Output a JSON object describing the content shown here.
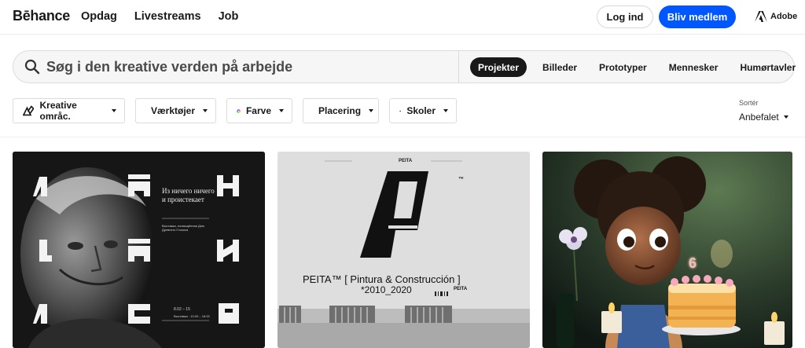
{
  "header": {
    "logo": "Bēhance",
    "nav": [
      "Opdag",
      "Livestreams",
      "Job"
    ],
    "login_label": "Log ind",
    "signup_label": "Bliv medlem",
    "adobe_label": "Adobe",
    "signup_color": "#0057ff"
  },
  "search": {
    "placeholder": "Søg i den kreative verden på arbejde",
    "tabs": [
      "Projekter",
      "Billeder",
      "Prototyper",
      "Mennesker",
      "Humørtavler"
    ],
    "active_tab": "Projekter"
  },
  "filters": [
    {
      "label": "Kreative områc.",
      "icon": "creative-fields-icon"
    },
    {
      "label": "Værktøjer",
      "icon": "tools-icon"
    },
    {
      "label": "Farve",
      "icon": "color-wheel-icon"
    },
    {
      "label": "Placering",
      "icon": "location-pin-icon"
    },
    {
      "label": "Skoler",
      "icon": "graduation-cap-icon"
    }
  ],
  "sort": {
    "label": "Sortér",
    "value": "Anbefalet"
  },
  "cards": [
    {
      "poster_heading": "Из ничего ничего и проистекает",
      "poster_small": "Выставка, посвящённая Дню Древнего Гнозиса",
      "poster_date": "8.02 – 15",
      "poster_date_sub": "Выставка · 10:00 – 18:00"
    },
    {
      "top_label": "PEITA",
      "title": "PEITA™ [ Pintura & Construcción ]",
      "subtitle": "*2010_2020",
      "brand": "PEITA",
      "tm": "™"
    },
    {
      "cake_number": "6"
    }
  ]
}
